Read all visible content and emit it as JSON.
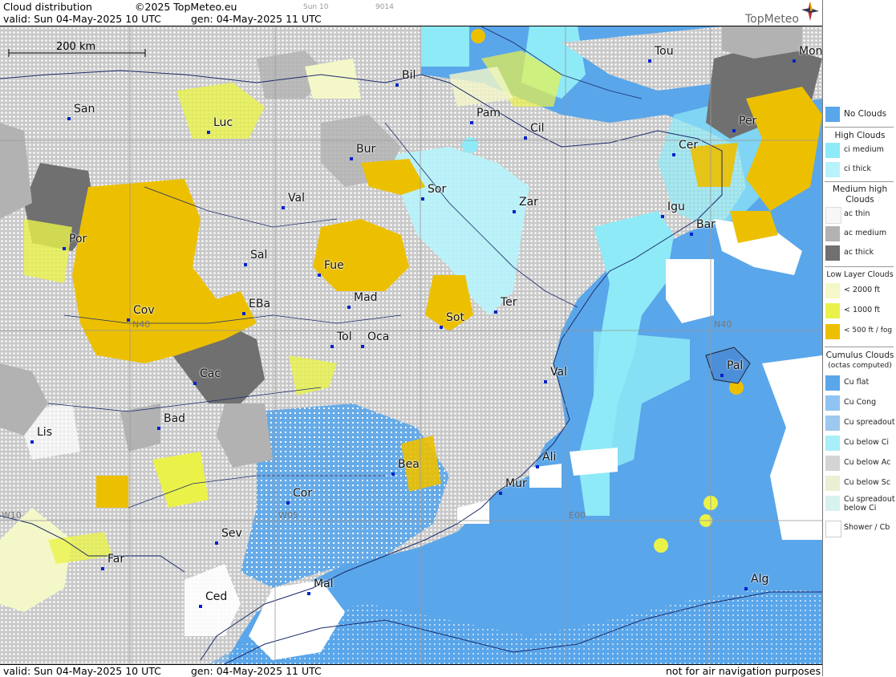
{
  "header": {
    "title": "Cloud distribution",
    "copyright": "©2025 TopMeteo.eu",
    "frame": "Sun 10",
    "code": "9014",
    "valid": "valid:  Sun  04-May-2025  10 UTC",
    "gen": "gen: 04-May-2025 11 UTC",
    "logo": "TopMeteo"
  },
  "map": {
    "scale_label": "200 km",
    "grid_labels": [
      "N40",
      "N40",
      "W05",
      "E00",
      "W10"
    ],
    "cities": [
      "Bil",
      "Tou",
      "Mon",
      "San",
      "Luc",
      "Pam",
      "Cil",
      "Per",
      "Bur",
      "Cer",
      "Sor",
      "Zar",
      "Val",
      "Igu",
      "Bar",
      "Por",
      "Sal",
      "Fue",
      "Mad",
      "Ter",
      "Cov",
      "EBa",
      "Sot",
      "Tol",
      "Oca",
      "Pal",
      "Val",
      "Cac",
      "Bad",
      "Lis",
      "Ali",
      "Bea",
      "Mur",
      "Cor",
      "Sev",
      "Far",
      "Alg",
      "Mal",
      "Ced"
    ]
  },
  "footer": {
    "valid": "valid:  Sun  04-May-2025  10 UTC",
    "gen": "gen: 04-May-2025 11 UTC",
    "note": "not for air navigation purposes"
  },
  "legend": {
    "no_clouds": "No Clouds",
    "high_title": "High Clouds",
    "ci_medium": "ci medium",
    "ci_thick": "ci thick",
    "medium_title_1": "Medium high",
    "medium_title_2": "Clouds",
    "ac_thin": "ac thin",
    "ac_medium": "ac medium",
    "ac_thick": "ac thick",
    "low_title": "Low Layer Clouds",
    "low_2000": "< 2000 ft",
    "low_1000": "< 1000 ft",
    "low_500": "< 500 ft / fog",
    "cu_title": "Cumulus Clouds",
    "cu_sub": "(octas computed)",
    "cu_flat": "Cu flat",
    "cu_cong": "Cu Cong",
    "cu_spread": "Cu spreadout",
    "cu_below_ci": "Cu below Ci",
    "cu_below_ac": "Cu below Ac",
    "cu_below_sc": "Cu below Sc",
    "cu_spread_ci_1": "Cu spreadout",
    "cu_spread_ci_2": "below Ci",
    "shower": "Shower / Cb"
  },
  "colors": {
    "no_clouds": "#5aa6ea",
    "ci_medium": "#8eeaf7",
    "ci_thick": "#b7f3fb",
    "ac_thin": "#f7f7f7",
    "ac_medium": "#b2b2b2",
    "ac_thick": "#707070",
    "low_2000": "#f4f8c8",
    "low_1000": "#eaf24a",
    "low_500": "#ecc000",
    "cu_below_ac": "#d4d4d4",
    "shower": "#ffffff"
  }
}
